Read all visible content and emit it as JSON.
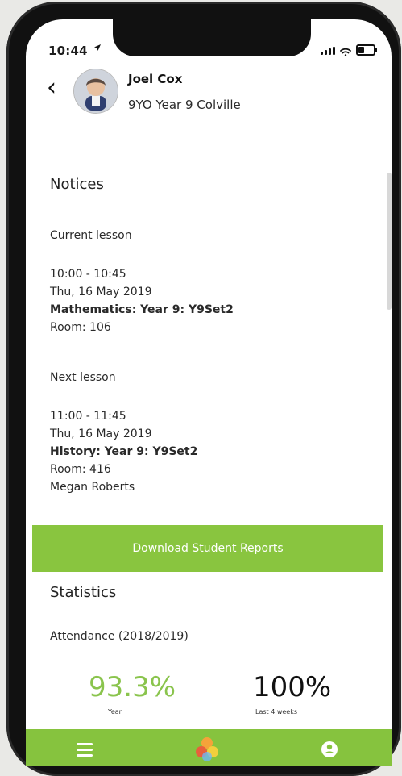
{
  "status_bar": {
    "time": "10:44",
    "location_icon": "location-arrow-icon",
    "signal_icon": "signal-icon",
    "wifi_icon": "wifi-icon",
    "battery_icon": "battery-icon"
  },
  "header": {
    "back_icon": "chevron-left-icon",
    "student_name": "Joel Cox",
    "student_meta": "9YO  Year 9  Colville",
    "avatar_icon": "student-avatar"
  },
  "notices": {
    "title": "Notices",
    "current_lesson_label": "Current lesson",
    "current_lesson": {
      "time": "10:00 - 10:45",
      "date": "Thu, 16 May 2019",
      "subject": "Mathematics: Year 9: Y9Set2",
      "room": "Room: 106"
    },
    "next_lesson_label": "Next lesson",
    "next_lesson": {
      "time": "11:00 - 11:45",
      "date": "Thu, 16 May 2019",
      "subject": "History: Year 9: Y9Set2",
      "room": "Room: 416",
      "teacher": "Megan Roberts"
    }
  },
  "download_button": {
    "label": "Download Student Reports"
  },
  "statistics": {
    "title": "Statistics",
    "attendance_label": "Attendance (2018/2019)",
    "year_value": "93.3%",
    "year_label": "Year",
    "last4_value": "100%",
    "last4_label": "Last 4 weeks"
  },
  "bottom_nav": {
    "menu_icon": "menu-icon",
    "logo_icon": "app-logo-icon",
    "user_icon": "user-icon"
  },
  "colors": {
    "accent_green": "#89c53f",
    "stat_green": "#8ac44d",
    "bottom_bar": "#86c33e"
  }
}
